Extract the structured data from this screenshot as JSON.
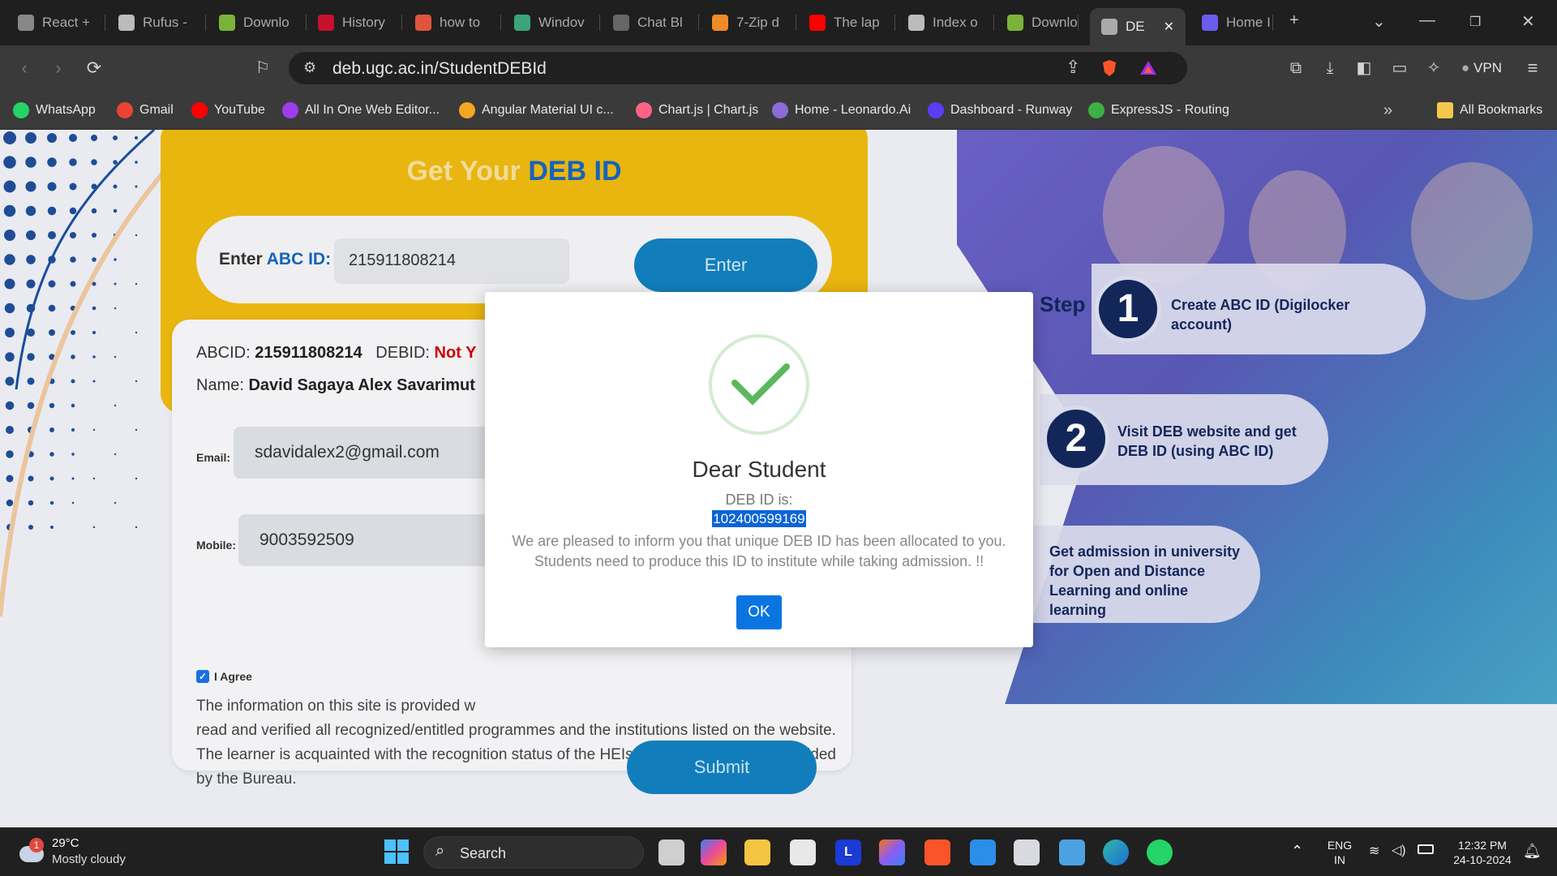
{
  "tabs": [
    {
      "label": "React +",
      "icon": "avatar-icon"
    },
    {
      "label": "Rufus -",
      "icon": "usb-icon"
    },
    {
      "label": "Downlo",
      "icon": "download-icon"
    },
    {
      "label": "History",
      "icon": "mt-icon"
    },
    {
      "label": "how to",
      "icon": "brave-icon"
    },
    {
      "label": "Windov",
      "icon": "openai-icon"
    },
    {
      "label": "Chat Bl",
      "icon": "chat-icon"
    },
    {
      "label": "7-Zip d",
      "icon": "diamond-icon"
    },
    {
      "label": "The lap",
      "icon": "youtube-icon"
    },
    {
      "label": "Index o",
      "icon": "usb-icon"
    },
    {
      "label": "Downlo",
      "icon": "download-icon"
    },
    {
      "label": "DE",
      "icon": "globe-icon",
      "active": true
    },
    {
      "label": "Home I",
      "icon": "cloud-icon"
    }
  ],
  "toolbar": {
    "url": "deb.ugc.ac.in/StudentDEBId",
    "vpn_label": "VPN"
  },
  "bookmarks": [
    {
      "label": "WhatsApp",
      "color": "#25d366"
    },
    {
      "label": "Gmail",
      "color": "#ea4335"
    },
    {
      "label": "YouTube",
      "color": "#ff0000"
    },
    {
      "label": "All In One Web Editor...",
      "color": "#a03cf0"
    },
    {
      "label": "Angular Material UI c...",
      "color": "#f5a623"
    },
    {
      "label": "Chart.js | Chart.js",
      "color": "#ff6384"
    },
    {
      "label": "Home - Leonardo.Ai",
      "color": "#8a6bd8"
    },
    {
      "label": "Dashboard - Runway",
      "color": "#5b3df5"
    },
    {
      "label": "ExpressJS - Routing",
      "color": "#3cb043"
    }
  ],
  "bookmarks_all": "All Bookmarks",
  "form": {
    "title_prefix": "Get Your ",
    "title_accent": "DEB ID",
    "abc_label_prefix": "Enter ",
    "abc_label_accent": "ABC ID:",
    "abc_value": "215911808214",
    "enter_label": "Enter",
    "abcid_label": "ABCID:",
    "abcid_value": "215911808214",
    "debid_label": "DEBID:",
    "debid_value": "Not Y",
    "name_label": "Name:",
    "name_value": "David Sagaya Alex Savarimut",
    "email_label": "Email:",
    "email_value": "sdavidalex2@gmail.com",
    "mobile_label": "Mobile:",
    "mobile_value": "9003592509",
    "agree_label": "I Agree",
    "terms_line1": "The information on this site is provided w",
    "terms_rest": "read and verified all recognized/entitled programmes and the institutions listed on the website. The learner is acquainted with the recognition status of the HEIs and the precautions provided by the Bureau.",
    "submit_label": "Submit"
  },
  "steps": {
    "word": "Step",
    "items": [
      {
        "num": "1",
        "text": "Create ABC ID (Digilocker account)"
      },
      {
        "num": "2",
        "text": "Visit DEB website and get DEB ID (using ABC ID)"
      },
      {
        "num": "",
        "text": "Get admission in university for Open and Distance Learning and online learning"
      }
    ]
  },
  "modal": {
    "title": "Dear Student",
    "subtitle": "DEB ID is:",
    "deb_id": "102400599169",
    "message": "We are pleased to inform you that unique DEB ID has been allocated to you. Students need to produce this ID to institute while taking admission. !!",
    "ok_label": "OK"
  },
  "taskbar": {
    "weather_temp": "29°C",
    "weather_desc": "Mostly cloudy",
    "weather_badge": "1",
    "search_label": "Search",
    "lang_top": "ENG",
    "lang_bottom": "IN",
    "time": "12:32 PM",
    "date": "24-10-2024"
  }
}
